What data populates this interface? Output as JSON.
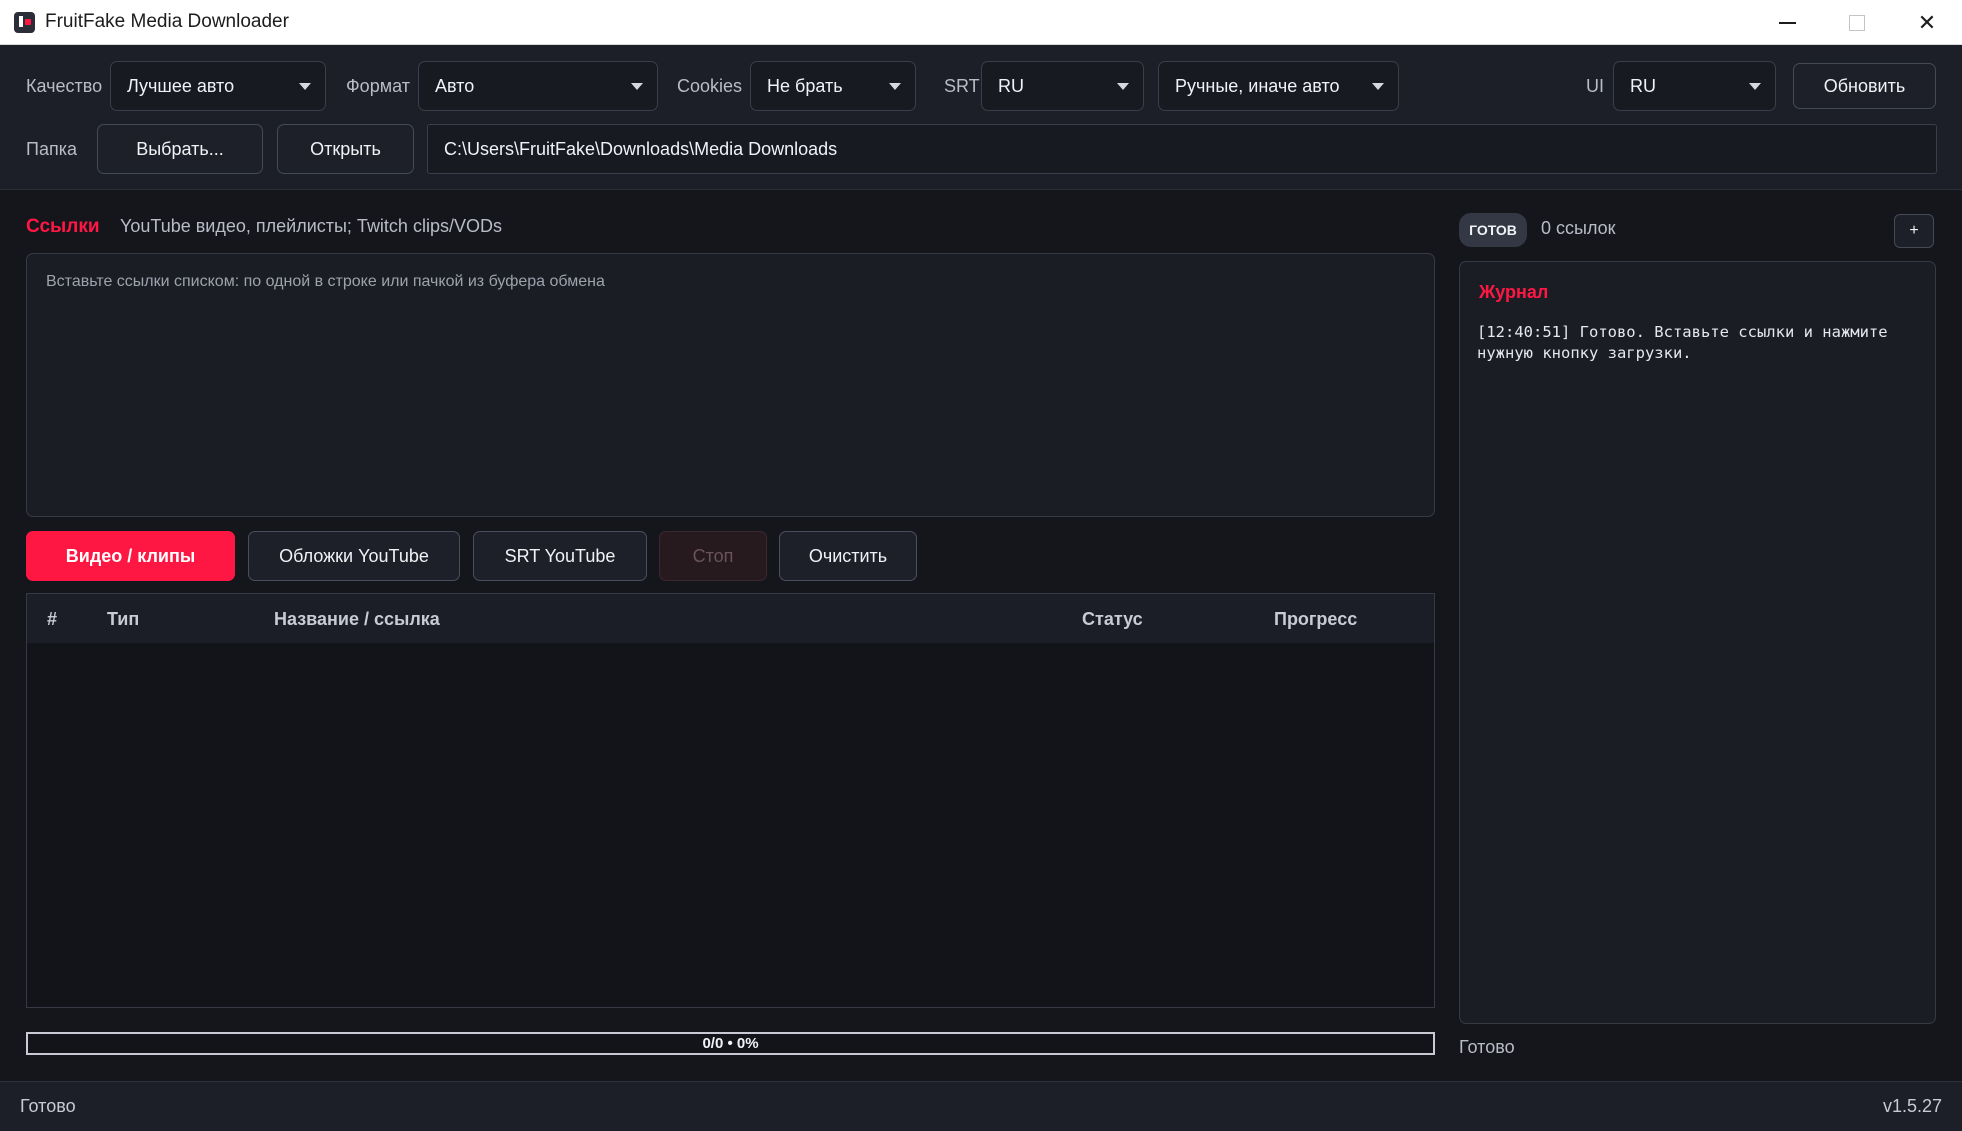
{
  "window": {
    "title": "FruitFake Media Downloader"
  },
  "toolbar": {
    "quality_label": "Качество",
    "quality_value": "Лучшее авто",
    "format_label": "Формат",
    "format_value": "Авто",
    "cookies_label": "Cookies",
    "cookies_value": "Не брать",
    "srt_label": "SRT",
    "srt_lang_value": "RU",
    "srt_mode_value": "Ручные, иначе авто",
    "ui_label": "UI",
    "ui_lang_value": "RU",
    "update_label": "Обновить",
    "folder_label": "Папка",
    "choose_label": "Выбрать...",
    "open_label": "Открыть",
    "folder_path": "C:\\Users\\FruitFake\\Downloads\\Media Downloads"
  },
  "links": {
    "title": "Ссылки",
    "hint": "YouTube видео, плейлисты; Twitch clips/VODs",
    "placeholder": "Вставьте ссылки списком: по одной в строке или пачкой из буфера обмена"
  },
  "actions": {
    "video_label": "Видео / клипы",
    "covers_label": "Обложки YouTube",
    "srt_label": "SRT YouTube",
    "stop_label": "Стоп",
    "clear_label": "Очистить"
  },
  "table": {
    "columns": [
      "#",
      "Тип",
      "Название / ссылка",
      "Статус",
      "Прогресс"
    ],
    "rows": []
  },
  "progress": {
    "text": "0/0 • 0%",
    "fraction": 0
  },
  "side": {
    "badge": "ГОТОВ",
    "count_text": "0 ссылок",
    "add_label": "+",
    "journal_title": "Журнал",
    "journal_text": "[12:40:51] Готово. Вставьте ссылки и нажмите нужную кнопку загрузки.",
    "status": "Готово"
  },
  "statusbar": {
    "left": "Готово",
    "version": "v1.5.27"
  },
  "colors": {
    "accent": "#ff1744",
    "background": "#14161c",
    "panel": "#1c1f27"
  }
}
